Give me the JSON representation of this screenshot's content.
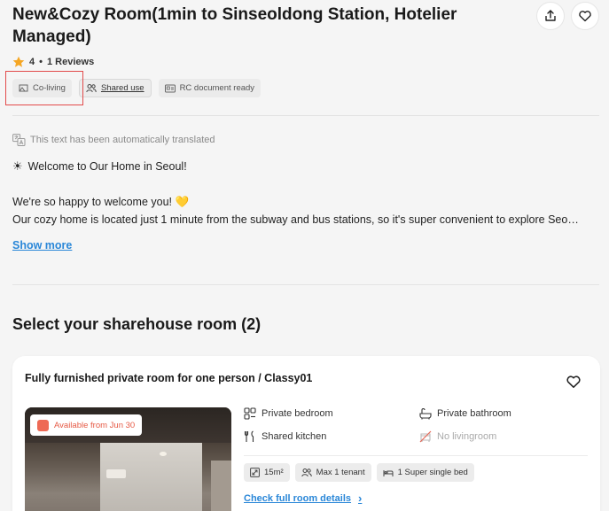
{
  "listing": {
    "title": "New&Cozy Room(1min to Sinseoldong Station, Hotelier Managed)",
    "rating": "4",
    "separator": "•",
    "reviews": "1 Reviews",
    "tags": [
      "Co-living",
      "Shared use",
      "RC document ready"
    ],
    "translated_notice": "This text has been automatically translated",
    "desc_line1": "Welcome to Our Home in Seoul!",
    "desc_line2": "We're so happy to welcome you! 💛",
    "desc_line3": "Our cozy home is located just 1 minute from the subway and bus stations, so it's super convenient to explore Seo…",
    "show_more": "Show more"
  },
  "rooms_section": {
    "title": "Select your sharehouse room (2)"
  },
  "room_card": {
    "title": "Fully furnished private room for one person / Classy01",
    "availability": "Available from Jun 30",
    "features": {
      "private_bedroom": "Private bedroom",
      "private_bathroom": "Private bathroom",
      "shared_kitchen": "Shared kitchen",
      "no_livingroom": "No livingroom"
    },
    "chips": [
      "15m²",
      "Max 1 tenant",
      "1 Super single bed"
    ],
    "check_details": "Check full room details"
  },
  "colors": {
    "link": "#2a87d8",
    "highlight_border": "#e24b4b",
    "availability": "#e65a45",
    "star": "#f5a623"
  },
  "icons": [
    "share-icon",
    "heart-icon",
    "star-icon",
    "co-living-icon",
    "users-icon",
    "document-icon",
    "translate-icon",
    "sun-emoji-icon",
    "bed-icon",
    "bath-icon",
    "kitchen-icon",
    "no-living-icon",
    "area-icon",
    "bed-chip-icon",
    "chevron-right-icon"
  ]
}
